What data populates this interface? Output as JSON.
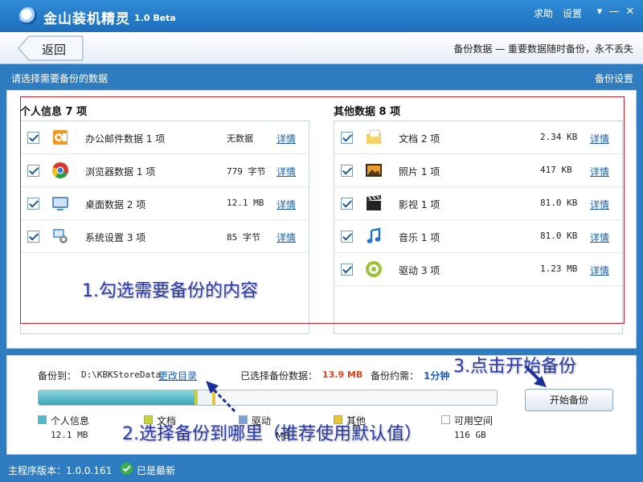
{
  "app": {
    "title": "金山装机精灵",
    "version": "1.0 Beta"
  },
  "titlebar": {
    "help": "求助",
    "settings": "设置"
  },
  "nav": {
    "back": "返回",
    "slogan": "备份数据 — 重要数据随时备份，永不丢失"
  },
  "strip": {
    "prompt": "请选择需要备份的数据",
    "settings": "备份设置"
  },
  "personal": {
    "title": "个人信息 7 项",
    "items": [
      {
        "icon": "outlook-icon",
        "name": "办公邮件数据 1 项",
        "size": "无数据",
        "link": "详情"
      },
      {
        "icon": "chrome-icon",
        "name": "浏览器数据 1 项",
        "size": "779 字节",
        "link": "详情"
      },
      {
        "icon": "desktop-icon",
        "name": "桌面数据 2 项",
        "size": "12.1 MB",
        "link": "详情"
      },
      {
        "icon": "system-settings-icon",
        "name": "系统设置 3 项",
        "size": "85 字节",
        "link": "详情"
      }
    ]
  },
  "other": {
    "title": "其他数据 8 项",
    "items": [
      {
        "icon": "document-icon",
        "name": "文档 2 项",
        "size": "2.34 KB",
        "link": "详情"
      },
      {
        "icon": "photo-icon",
        "name": "照片 1 项",
        "size": "417 KB",
        "link": "详情"
      },
      {
        "icon": "film-icon",
        "name": "影视 1 项",
        "size": "81.0 KB",
        "link": "详情"
      },
      {
        "icon": "music-icon",
        "name": "音乐 1 项",
        "size": "81.0 KB",
        "link": "详情"
      },
      {
        "icon": "driver-icon",
        "name": "驱动 3 项",
        "size": "1.23 MB",
        "link": "详情"
      }
    ]
  },
  "annotations": {
    "step1": "1.勾选需要备份的内容",
    "step2": "2.选择备份到哪里（推荐使用默认值）",
    "step3": "3.点击开始备份"
  },
  "backup": {
    "to_label": "备份到：",
    "path": "D:\\KBKStoreData",
    "change": "更改目录",
    "selected_label": "已选择备份数据：",
    "selected_value": "13.9 MB",
    "time_label": "备份约需：",
    "time_value": "1分钟",
    "start": "开始备份",
    "legend": [
      {
        "label": "个人信息",
        "value": "12.1 MB",
        "color": "#52b9c9"
      },
      {
        "label": "文档",
        "value": "",
        "color": "#c8d23a"
      },
      {
        "label": "驱动",
        "value": "",
        "color": "#7c9fd6"
      },
      {
        "label": "其他",
        "value": "",
        "color": "#e8c63a"
      },
      {
        "label": "可用空间",
        "value": "116 GB",
        "color": "#ffffff"
      }
    ],
    "partial_value": "MB"
  },
  "footer": {
    "version": "主程序版本：1.0.0.161",
    "status": "已是最新"
  }
}
